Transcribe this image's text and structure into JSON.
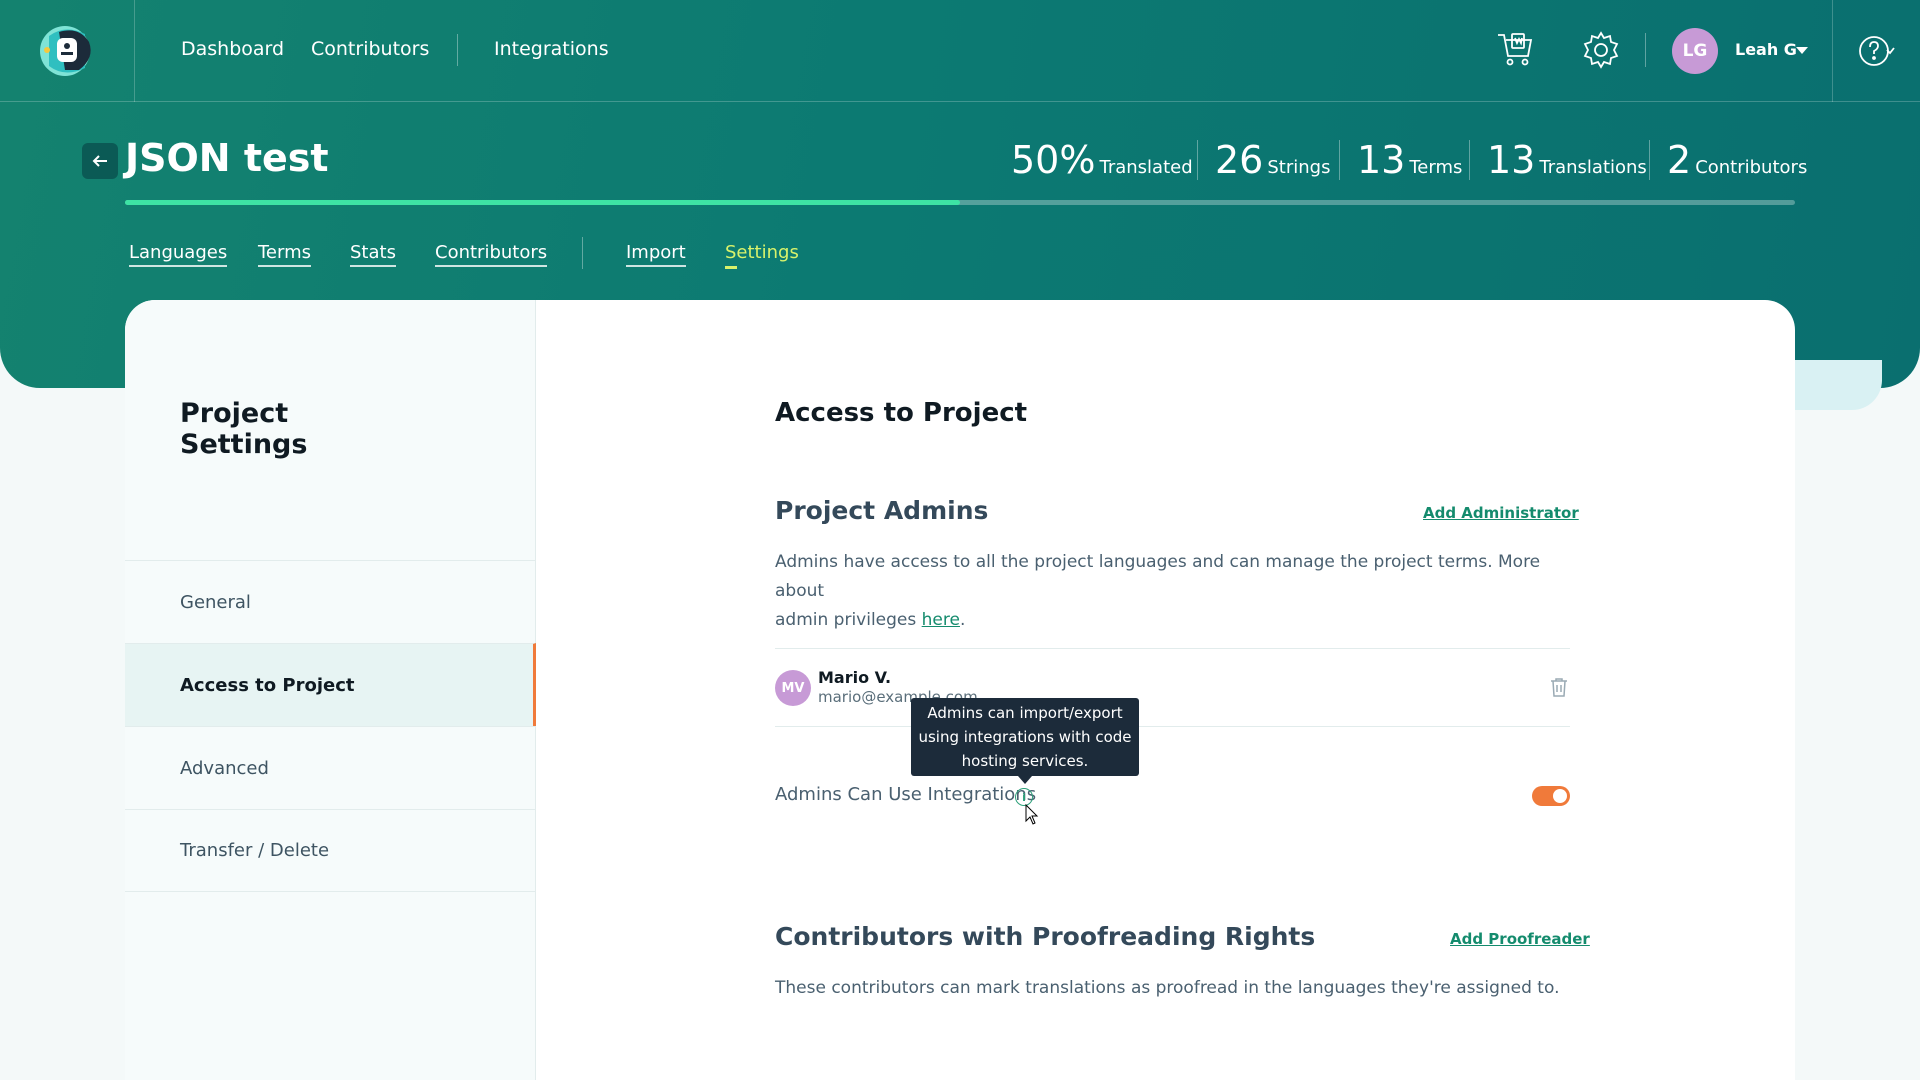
{
  "nav": {
    "links": [
      "Dashboard",
      "Contributors",
      "Integrations"
    ],
    "user_initials": "LG",
    "user_name": "Leah G"
  },
  "project": {
    "title": "JSON test",
    "stats": [
      {
        "num": "50%",
        "label": "Translated"
      },
      {
        "num": "26",
        "label": "Strings"
      },
      {
        "num": "13",
        "label": "Terms"
      },
      {
        "num": "13",
        "label": "Translations"
      },
      {
        "num": "2",
        "label": "Contributors"
      }
    ],
    "progress_fraction": 0.5,
    "tabs": [
      "Languages",
      "Terms",
      "Stats",
      "Contributors",
      "Import",
      "Settings"
    ],
    "active_tab": "Settings"
  },
  "sidebar": {
    "title_line1": "Project",
    "title_line2": "Settings",
    "items": [
      "General",
      "Access to Project",
      "Advanced",
      "Transfer / Delete"
    ],
    "active_item": "Access to Project"
  },
  "content": {
    "title": "Access to Project",
    "admins": {
      "title": "Project Admins",
      "add_label": "Add Administrator",
      "desc_line1": "Admins have access to all the project languages and can manage the project terms. More about",
      "desc_line2_prefix": "admin privileges ",
      "desc_link": "here",
      "desc_suffix": ".",
      "member": {
        "initials": "MV",
        "name": "Mario V.",
        "email": "mario@example.com"
      },
      "toggle_label": "Admins Can Use Integrations",
      "toggle_on": true,
      "tooltip": "Admins can import/export using integrations with code hosting services."
    },
    "proofreaders": {
      "title": "Contributors with Proofreading Rights",
      "add_label": "Add Proofreader",
      "desc": "These contributors can mark translations as proofread in the languages they're assigned to."
    }
  },
  "colors": {
    "brand_teal": "#0c7a72",
    "accent_green": "#148b6d",
    "active_tab": "#d8f26b",
    "toggle_orange": "#f07a3a",
    "avatar_purple": "#c79ad6"
  }
}
